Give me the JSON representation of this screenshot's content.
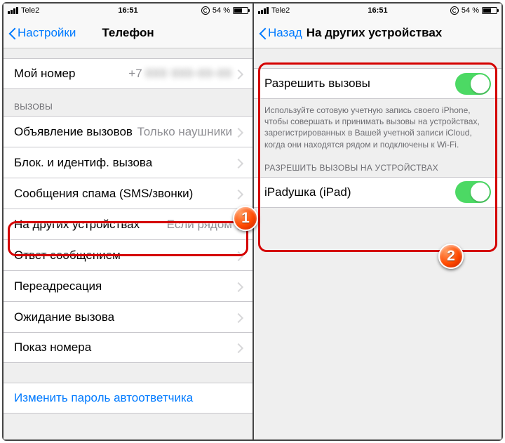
{
  "status": {
    "carrier": "Tele2",
    "time": "16:51",
    "battery_text": "54 %"
  },
  "left": {
    "nav_back": "Настройки",
    "nav_title": "Телефон",
    "my_number_label": "Мой номер",
    "my_number_prefix": "+7",
    "my_number_value": "000 000-00-00",
    "section_calls": "ВЫЗОВЫ",
    "announce_label": "Объявление вызовов",
    "announce_detail": "Только наушники",
    "block_label": "Блок. и идентиф. вызова",
    "spam_label": "Сообщения спама (SMS/звонки)",
    "other_devices_label": "На других устройствах",
    "other_devices_detail": "Если рядом",
    "reply_label": "Ответ сообщением",
    "forward_label": "Переадресация",
    "waiting_label": "Ожидание вызова",
    "callerid_label": "Показ номера",
    "vm_password_label": "Изменить пароль автоответчика"
  },
  "right": {
    "nav_back": "Назад",
    "nav_title": "На других устройствах",
    "allow_label": "Разрешить вызовы",
    "allow_on": true,
    "help_text": "Используйте сотовую учетную запись своего iPhone, чтобы совершать и принимать вызовы на устройствах, зарегистрированных в Вашей учетной записи iCloud, когда они находятся рядом и подключены к Wi-Fi.",
    "section_devices": "РАЗРЕШИТЬ ВЫЗОВЫ НА УСТРОЙСТВАХ",
    "device1_label": "iPadушка (iPad)",
    "device1_on": true
  },
  "badges": {
    "one": "1",
    "two": "2"
  }
}
